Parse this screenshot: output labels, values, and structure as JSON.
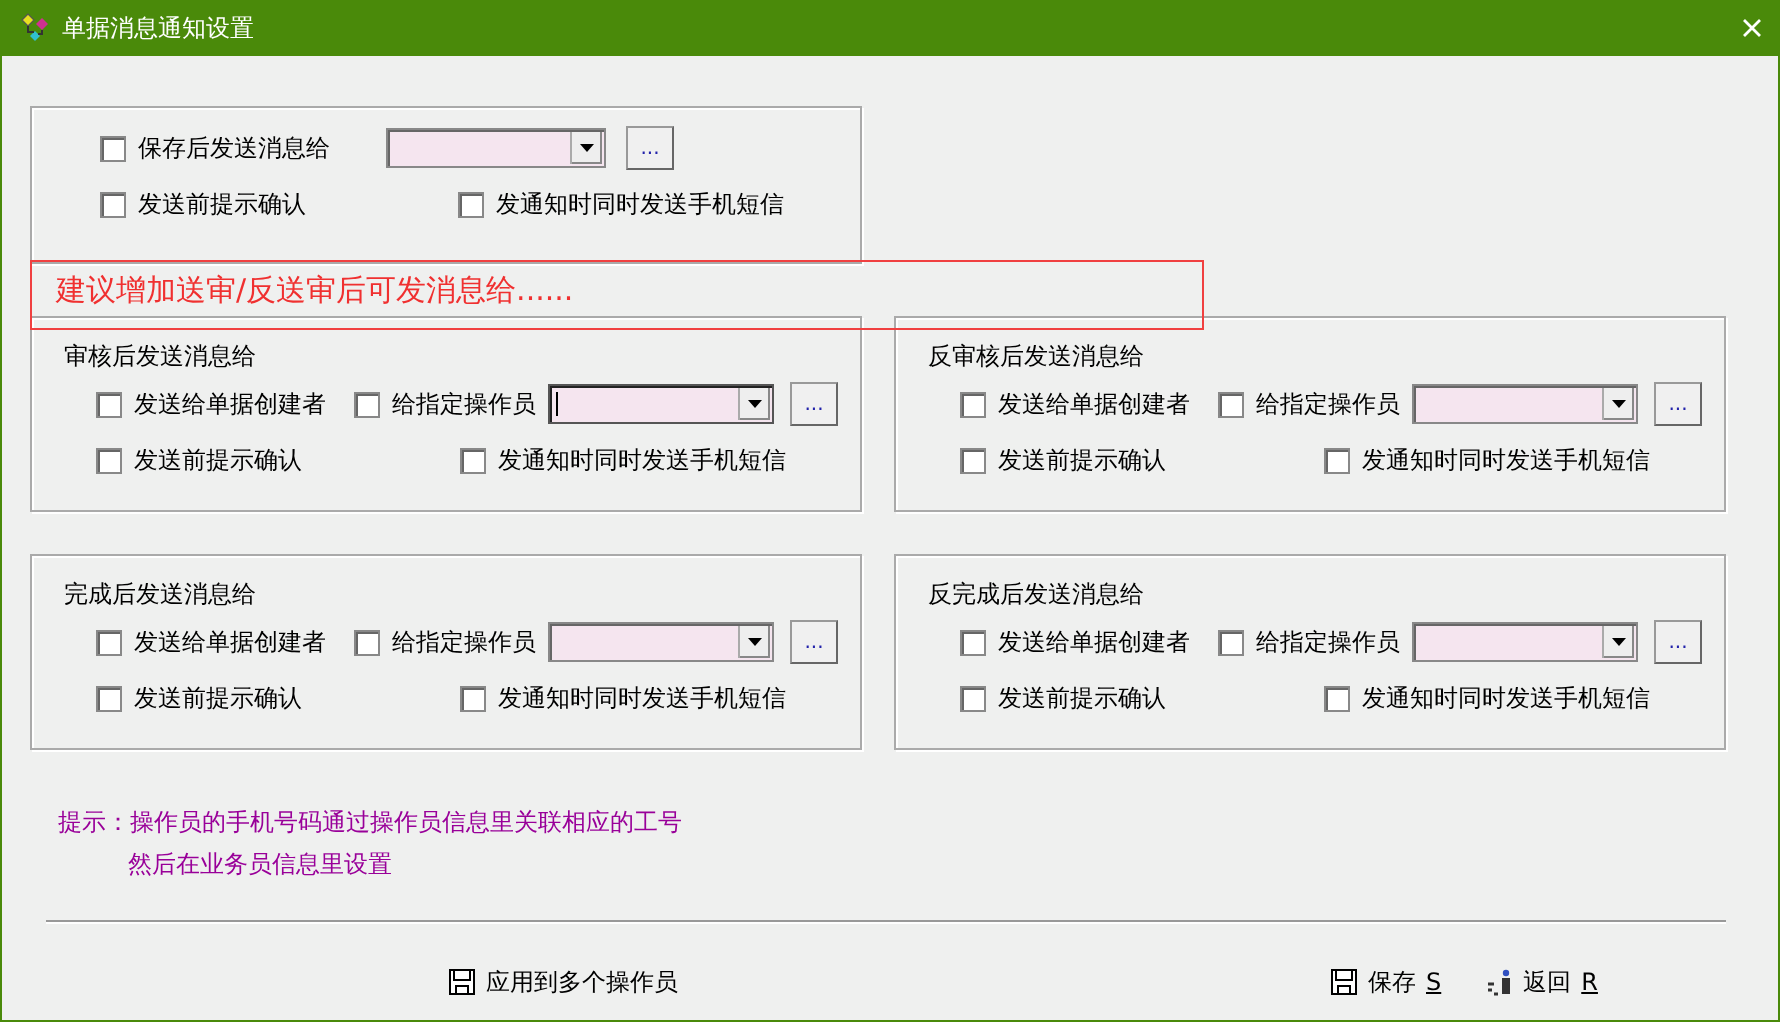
{
  "window": {
    "title": "单据消息通知设置"
  },
  "save_panel": {
    "send": {
      "label": "保存后发送消息给",
      "checked": false
    },
    "dropdown": {
      "focused": false
    },
    "more": "...",
    "confirm": {
      "label": "发送前提示确认",
      "checked": false
    },
    "sms": {
      "label": "发通知时同时发送手机短信",
      "checked": false
    }
  },
  "annotation": "建议增加送审/反送审后可发消息给......",
  "panels": [
    {
      "title": "审核后发送消息给",
      "creator": {
        "label": "发送给单据创建者",
        "checked": false
      },
      "operator": {
        "label": "给指定操作员",
        "checked": false
      },
      "dropdown": {
        "focused": true
      },
      "more": "...",
      "confirm": {
        "label": "发送前提示确认",
        "checked": false
      },
      "sms": {
        "label": "发通知时同时发送手机短信",
        "checked": false
      }
    },
    {
      "title": "反审核后发送消息给",
      "creator": {
        "label": "发送给单据创建者",
        "checked": false
      },
      "operator": {
        "label": "给指定操作员",
        "checked": false
      },
      "dropdown": {
        "focused": false
      },
      "more": "...",
      "confirm": {
        "label": "发送前提示确认",
        "checked": false
      },
      "sms": {
        "label": "发通知时同时发送手机短信",
        "checked": false
      }
    },
    {
      "title": "完成后发送消息给",
      "creator": {
        "label": "发送给单据创建者",
        "checked": false
      },
      "operator": {
        "label": "给指定操作员",
        "checked": false
      },
      "dropdown": {
        "focused": false
      },
      "more": "...",
      "confirm": {
        "label": "发送前提示确认",
        "checked": false
      },
      "sms": {
        "label": "发通知时同时发送手机短信",
        "checked": false
      }
    },
    {
      "title": "反完成后发送消息给",
      "creator": {
        "label": "发送给单据创建者",
        "checked": false
      },
      "operator": {
        "label": "给指定操作员",
        "checked": false
      },
      "dropdown": {
        "focused": false
      },
      "more": "...",
      "confirm": {
        "label": "发送前提示确认",
        "checked": false
      },
      "sms": {
        "label": "发通知时同时发送手机短信",
        "checked": false
      }
    }
  ],
  "hint": [
    "提示：操作员的手机号码通过操作员信息里关联相应的工号",
    "然后在业务员信息里设置"
  ],
  "buttons": [
    {
      "kind": "save",
      "label": "应用到多个操作员"
    },
    {
      "kind": "save",
      "label": "保存",
      "shortcut": "S"
    },
    {
      "kind": "back",
      "label": "返回",
      "shortcut": "R"
    }
  ]
}
